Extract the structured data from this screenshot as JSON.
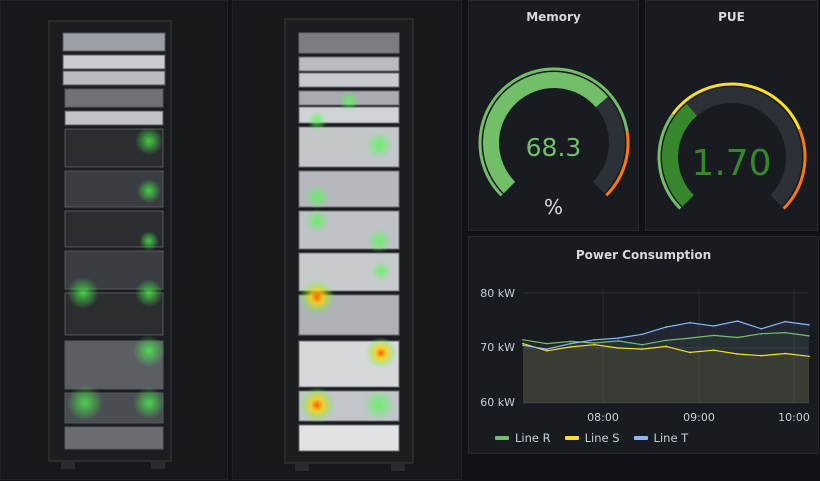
{
  "memory": {
    "title": "Memory",
    "value": "68.3",
    "unit": "%",
    "fraction": 0.683
  },
  "pue": {
    "title": "PUE",
    "value": "1.70",
    "fraction": 0.35
  },
  "power": {
    "title": "Power Consumption",
    "y_ticks": [
      "80 kW",
      "70 kW",
      "60 kW"
    ],
    "x_ticks": [
      "08:00",
      "09:00",
      "10:00"
    ],
    "legend": [
      "Line R",
      "Line S",
      "Line T"
    ]
  },
  "colors": {
    "green": "#73bf69",
    "yellow": "#fade2a",
    "blue": "#8ab8ff",
    "orange": "#ff780a",
    "track": "#2c3037"
  },
  "chart_data": {
    "type": "line",
    "title": "Power Consumption",
    "ylim": [
      60,
      80
    ],
    "x": [
      "07:15",
      "07:30",
      "07:45",
      "08:00",
      "08:15",
      "08:30",
      "08:45",
      "09:00",
      "09:15",
      "09:30",
      "09:45",
      "10:00",
      "10:15"
    ],
    "series": [
      {
        "name": "Line R",
        "color": "#73bf69",
        "values": [
          71.5,
          70.8,
          71.2,
          70.9,
          71.3,
          70.6,
          71.4,
          71.8,
          72.3,
          71.9,
          72.6,
          72.8,
          72.2
        ]
      },
      {
        "name": "Line S",
        "color": "#fade2a",
        "values": [
          70.8,
          69.5,
          70.2,
          70.6,
          70.0,
          69.8,
          70.3,
          69.2,
          69.6,
          68.9,
          68.6,
          69.0,
          68.5
        ]
      },
      {
        "name": "Line T",
        "color": "#8ab8ff",
        "values": [
          70.5,
          69.8,
          70.8,
          71.5,
          71.8,
          72.5,
          73.8,
          74.6,
          74.0,
          74.9,
          73.5,
          74.8,
          74.2
        ]
      }
    ]
  }
}
